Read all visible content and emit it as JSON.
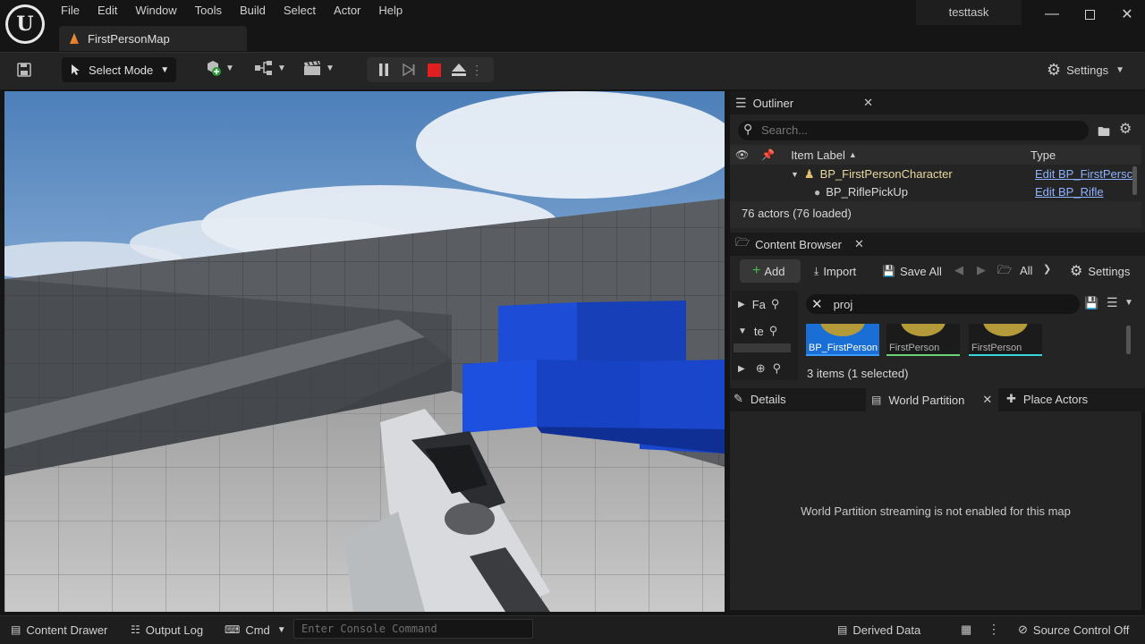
{
  "app": {
    "project_name": "testtask",
    "map_tab": "FirstPersonMap"
  },
  "menu": [
    "File",
    "Edit",
    "Window",
    "Tools",
    "Build",
    "Select",
    "Actor",
    "Help"
  ],
  "toolbar": {
    "select_mode": "Select Mode",
    "settings": "Settings"
  },
  "outliner": {
    "title": "Outliner",
    "search_placeholder": "Search...",
    "col_label": "Item Label",
    "col_type": "Type",
    "rows": [
      {
        "label": "BP_FirstPersonCharacter",
        "type": "Edit BP_FirstPersc"
      },
      {
        "label": "BP_RiflePickUp",
        "type": "Edit BP_Rifle"
      }
    ],
    "footer": "76 actors (76 loaded)"
  },
  "content_browser": {
    "title": "Content Browser",
    "add": "Add",
    "import": "Import",
    "save_all": "Save All",
    "all": "All",
    "settings": "Settings",
    "tree_1": "Fa",
    "tree_2": "te",
    "search_value": "proj",
    "thumbs": [
      "BP_FirstPerson",
      "FirstPerson",
      "FirstPerson"
    ],
    "footer": "3 items (1 selected)"
  },
  "bottom_tabs": {
    "details": "Details",
    "world_partition": "World Partition",
    "place_actors": "Place Actors"
  },
  "world_partition": {
    "message": "World Partition streaming is not enabled for this map"
  },
  "statusbar": {
    "content_drawer": "Content Drawer",
    "output_log": "Output Log",
    "cmd": "Cmd",
    "console_placeholder": "Enter Console Command",
    "derived_data": "Derived Data",
    "source_control": "Source Control Off"
  },
  "colors": {
    "accent_blue": "#1a6fd6",
    "stop_red": "#e02020",
    "link": "#8fb2ff"
  }
}
